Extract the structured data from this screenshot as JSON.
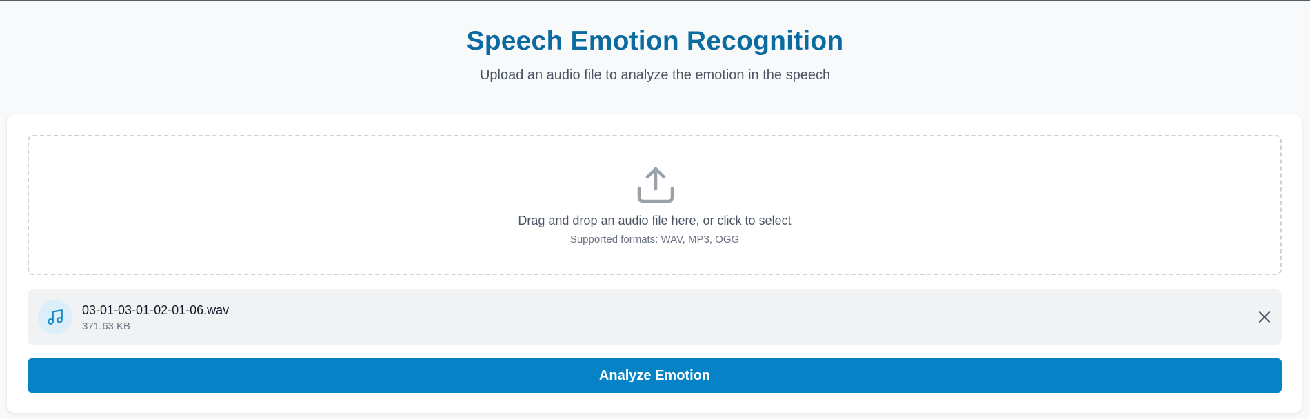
{
  "header": {
    "title": "Speech Emotion Recognition",
    "subtitle": "Upload an audio file to analyze the emotion in the speech"
  },
  "dropzone": {
    "icon": "upload-icon",
    "text": "Drag and drop an audio file here, or click to select",
    "formats": "Supported formats: WAV, MP3, OGG"
  },
  "file": {
    "icon": "music-note-icon",
    "name": "03-01-03-01-02-01-06.wav",
    "size": "371.63 KB",
    "remove_icon": "close-icon"
  },
  "actions": {
    "analyze_label": "Analyze Emotion"
  },
  "colors": {
    "title": "#0b6a9e",
    "primary_button": "#0683c6",
    "file_icon_bg": "#dbeefa",
    "page_bg": "#f8f9fb"
  }
}
